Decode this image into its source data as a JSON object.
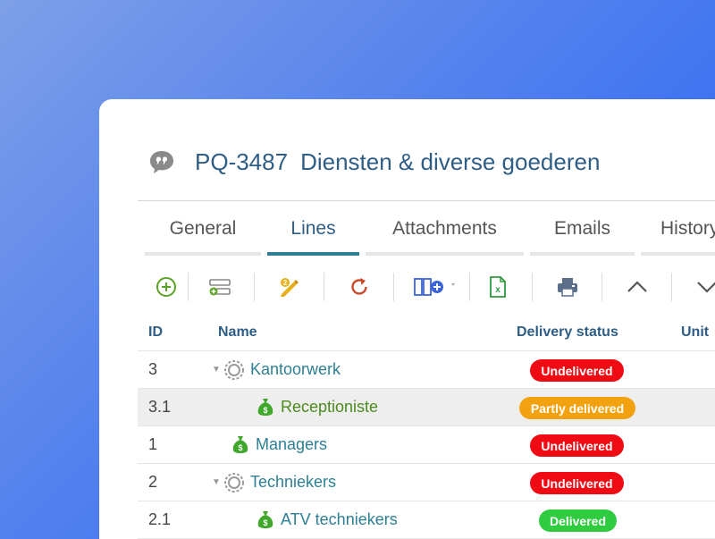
{
  "header": {
    "code": "PQ-3487",
    "title": "Diensten & diverse goederen",
    "icon": "quote-bubble-icon"
  },
  "tabs": [
    {
      "label": "General",
      "active": false
    },
    {
      "label": "Lines",
      "active": true
    },
    {
      "label": "Attachments",
      "active": false
    },
    {
      "label": "Emails",
      "active": false
    },
    {
      "label": "History",
      "active": false
    }
  ],
  "toolbar": {
    "buttons": [
      "add-line-icon",
      "add-group-icon",
      "edit-lines-icon",
      "refresh-icon",
      "columns-add-icon",
      "excel-export-icon",
      "print-icon",
      "move-up-icon",
      "move-down-icon"
    ]
  },
  "grid": {
    "columns": {
      "id": "ID",
      "name": "Name",
      "delivery": "Delivery status",
      "unit": "Unit"
    },
    "rows": [
      {
        "id": "3",
        "name": "Kantoorwerk",
        "status": "Undelivered",
        "type": "group",
        "indent": 0,
        "highlight": false
      },
      {
        "id": "3.1",
        "name": "Receptioniste",
        "status": "Partly delivered",
        "type": "item",
        "indent": 1,
        "highlight": true
      },
      {
        "id": "1",
        "name": "Managers",
        "status": "Undelivered",
        "type": "item",
        "indent": 0,
        "highlight": false
      },
      {
        "id": "2",
        "name": "Techniekers",
        "status": "Undelivered",
        "type": "group",
        "indent": 0,
        "highlight": false
      },
      {
        "id": "2.1",
        "name": "ATV techniekers",
        "status": "Delivered",
        "type": "item",
        "indent": 1,
        "highlight": false
      }
    ]
  },
  "colors": {
    "undelivered": "#f00a13",
    "partly_delivered": "#f3a20f",
    "delivered": "#2fcc3f",
    "accent": "#2e7f95",
    "title": "#2e5d86"
  }
}
